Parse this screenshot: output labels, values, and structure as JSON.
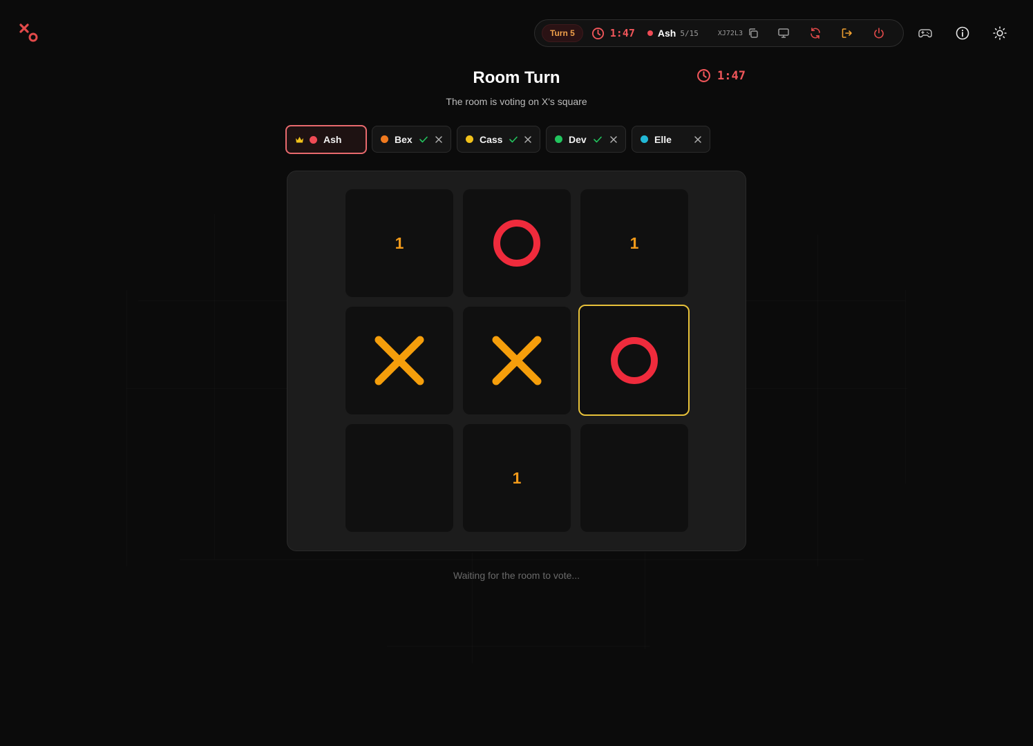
{
  "header": {
    "turn_label": "Turn 5",
    "timer": "1:47",
    "current_player": "Ash",
    "player_count": "5/15",
    "room_code": "XJ72L3"
  },
  "main": {
    "title": "Room Turn",
    "subtitle": "The room is voting on X's square",
    "timer": "1:47",
    "footer": "Waiting for the room to vote..."
  },
  "players": [
    {
      "name": "Ash",
      "color": "#ef4b55",
      "host": true,
      "voted": false,
      "active": true
    },
    {
      "name": "Bex",
      "color": "#f07a1f",
      "host": false,
      "voted": true,
      "active": false
    },
    {
      "name": "Cass",
      "color": "#f2c21b",
      "host": false,
      "voted": true,
      "active": false
    },
    {
      "name": "Dev",
      "color": "#22c55e",
      "host": false,
      "voted": true,
      "active": false
    },
    {
      "name": "Elle",
      "color": "#22b8d6",
      "host": false,
      "voted": false,
      "active": false
    }
  ],
  "board": {
    "cells": [
      {
        "mark": "",
        "votes": "1"
      },
      {
        "mark": "O",
        "votes": ""
      },
      {
        "mark": "",
        "votes": "1"
      },
      {
        "mark": "X",
        "votes": ""
      },
      {
        "mark": "X",
        "votes": ""
      },
      {
        "mark": "O",
        "votes": "",
        "highlighted": true
      },
      {
        "mark": "",
        "votes": ""
      },
      {
        "mark": "",
        "votes": "1"
      },
      {
        "mark": "",
        "votes": ""
      }
    ]
  },
  "colors": {
    "x_mark": "#f59e0b",
    "o_mark": "#ef2b3c",
    "accent": "#f0565a",
    "highlight": "#e8c23a"
  }
}
